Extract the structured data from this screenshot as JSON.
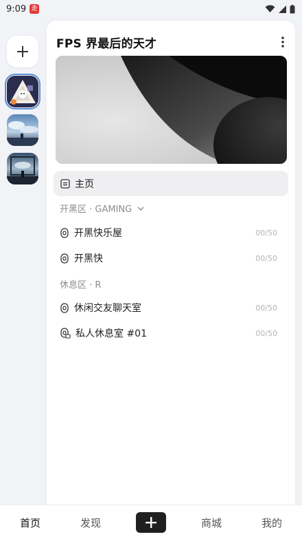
{
  "status_bar": {
    "time": "9:09",
    "notification_glyph": "走",
    "icons": [
      "wifi-icon",
      "signal-icon",
      "battery-icon"
    ]
  },
  "rail": {
    "add_icon": "plus-icon",
    "servers": [
      {
        "name": "server-avatar-1",
        "active": true
      },
      {
        "name": "server-avatar-2",
        "active": false
      },
      {
        "name": "server-avatar-3",
        "active": false
      }
    ]
  },
  "panel": {
    "title": "FPS 界最后的天才",
    "home_label": "主页",
    "categories": [
      {
        "label": "开黑区 · GAMING"
      },
      {
        "label": "休息区 · R"
      }
    ],
    "channels": [
      {
        "name": "开黑快乐屋",
        "count": "00/50"
      },
      {
        "name": "开黑快",
        "count": "00/50"
      },
      {
        "name": "休闲交友聊天室",
        "count": "00/50"
      },
      {
        "name": "私人休息室 #01",
        "count": "00/50"
      }
    ]
  },
  "bottom_nav": {
    "tabs": [
      "首页",
      "发现",
      "商城",
      "我的"
    ],
    "active_tab": "首页"
  },
  "colors": {
    "accent_active_outline": "#5b8fd6",
    "notification_red": "#e53935",
    "plus_button": "#1f1f1f"
  }
}
